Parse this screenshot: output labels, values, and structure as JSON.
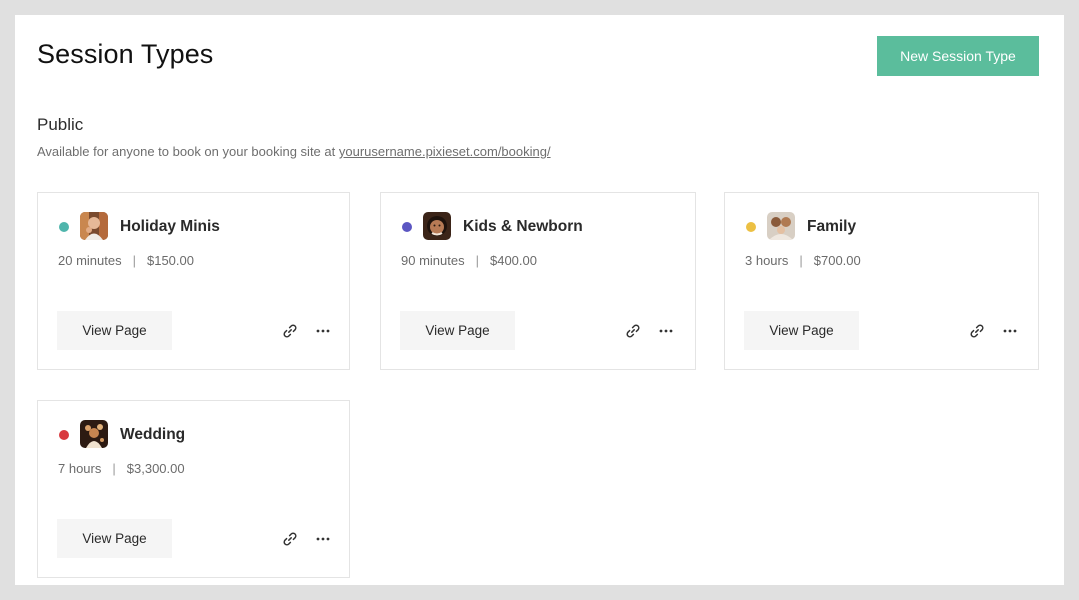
{
  "header": {
    "title": "Session Types",
    "new_button_label": "New Session Type",
    "accent_color": "#5bbd9c"
  },
  "section": {
    "title": "Public",
    "description": "Available for anyone to book on your booking site at ",
    "link_text": "yourusername.pixieset.com/booking/"
  },
  "cards": [
    {
      "name": "Holiday Minis",
      "duration": "20 minutes",
      "separator": "|",
      "price": "$150.00",
      "dot_color": "#4fb5ac",
      "view_label": "View Page",
      "link_icon": "link-icon",
      "more_icon": "more-icon"
    },
    {
      "name": "Kids & Newborn",
      "duration": "90 minutes",
      "separator": "|",
      "price": "$400.00",
      "dot_color": "#5b56c2",
      "view_label": "View Page",
      "link_icon": "link-icon",
      "more_icon": "more-icon"
    },
    {
      "name": "Family",
      "duration": "3 hours",
      "separator": "|",
      "price": "$700.00",
      "dot_color": "#ecc043",
      "view_label": "View Page",
      "link_icon": "link-icon",
      "more_icon": "more-icon"
    },
    {
      "name": "Wedding",
      "duration": "7 hours",
      "separator": "|",
      "price": "$3,300.00",
      "dot_color": "#d8393e",
      "view_label": "View Page",
      "link_icon": "link-icon",
      "more_icon": "more-icon"
    }
  ]
}
